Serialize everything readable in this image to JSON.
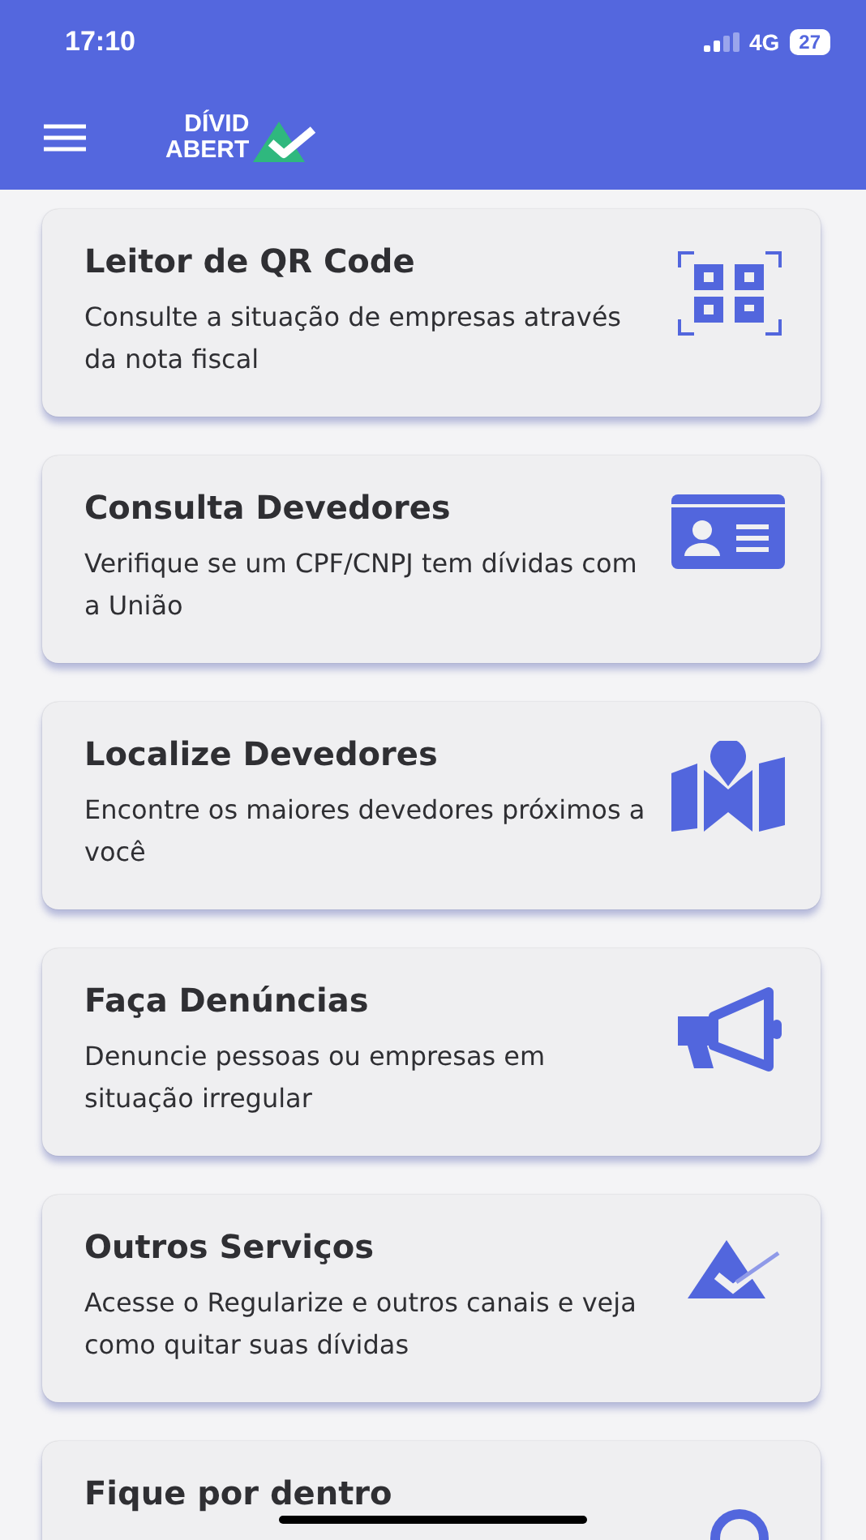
{
  "status_bar": {
    "time": "17:10",
    "network": "4G",
    "battery": "27"
  },
  "app_bar": {
    "logo_line_1": "DÍVID",
    "logo_line_2": "ABERT"
  },
  "cards": [
    {
      "kind": "qr",
      "title": "Leitor de QR Code",
      "description": "Consulte a situação de empresas através da nota fiscal"
    },
    {
      "kind": "id",
      "title": "Consulta Devedores",
      "description": "Verifique se um CPF/CNPJ tem dívidas com a União"
    },
    {
      "kind": "map",
      "title": "Localize Devedores",
      "description": "Encontre os maiores devedores próximos a você"
    },
    {
      "kind": "megaphone",
      "title": "Faça Denúncias",
      "description": "Denuncie pessoas ou empresas em situação irregular"
    },
    {
      "kind": "regularize",
      "title": "Outros Serviços",
      "description": "Acesse o Regularize e outros canais e veja como quitar suas dívidas"
    },
    {
      "kind": "search",
      "title": "Fique por dentro"
    }
  ]
}
